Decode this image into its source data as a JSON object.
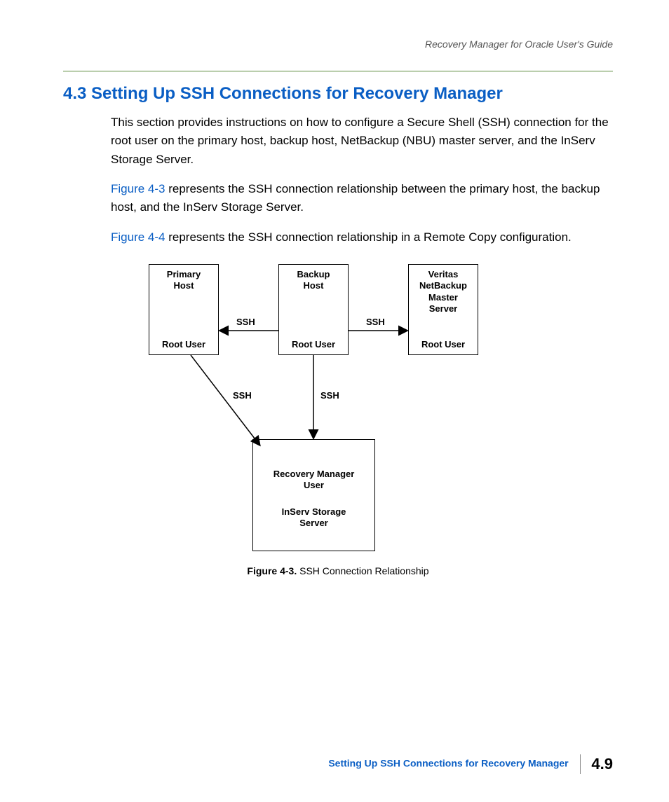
{
  "header": {
    "running_head": "Recovery Manager for Oracle User's Guide"
  },
  "section": {
    "number": "4.3",
    "title": "Setting Up SSH Connections for Recovery Manager"
  },
  "paragraphs": {
    "p1": "This section provides instructions on how to configure a Secure Shell (SSH) connection for the root user on the primary host, backup host, NetBackup (NBU) master server, and the InServ Storage Server.",
    "p2_link": "Figure 4-3",
    "p2_rest": " represents the SSH connection relationship between the primary host, the backup host, and the InServ Storage Server.",
    "p3_link": "Figure 4-4",
    "p3_rest": " represents the SSH connection relationship in a Remote Copy configuration."
  },
  "diagram": {
    "boxes": {
      "primary": {
        "top": "Primary\nHost",
        "bottom": "Root User"
      },
      "backup": {
        "top": "Backup\nHost",
        "bottom": "Root User"
      },
      "netbackup": {
        "top": "Veritas\nNetBackup\nMaster\nServer",
        "bottom": "Root User"
      },
      "inserv": {
        "top": "Recovery Manager\nUser",
        "bottom": "InServ Storage\nServer"
      }
    },
    "labels": {
      "ssh": "SSH"
    }
  },
  "figure_caption": {
    "label": "Figure 4-3.",
    "text": "  SSH Connection Relationship"
  },
  "footer": {
    "section_title": "Setting Up SSH Connections for Recovery Manager",
    "page_number": "4.9"
  }
}
